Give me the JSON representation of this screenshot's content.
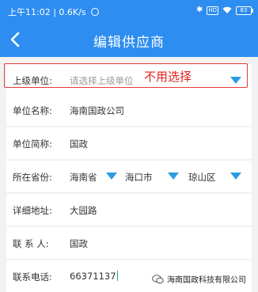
{
  "status_bar": {
    "time": "上午11:02",
    "speed": "0.6K/s",
    "battery": "83"
  },
  "header": {
    "title": "编辑供应商"
  },
  "form": {
    "parent": {
      "label": "上级单位:",
      "placeholder": "请选择上级单位"
    },
    "name": {
      "label": "单位名称:",
      "value": "海南国政公司"
    },
    "short_name": {
      "label": "单位简称:",
      "value": "国政"
    },
    "location": {
      "label": "所在省份:",
      "province": "海南省",
      "city": "海口市",
      "district": "琼山区"
    },
    "address": {
      "label": "详细地址:",
      "value": "大园路"
    },
    "contact": {
      "label": "联 系 人:",
      "value": "国政"
    },
    "phone": {
      "label": "联系电话:",
      "value": "66371137"
    }
  },
  "annotation": {
    "text": "不用选择",
    "color": "#e0201f"
  },
  "watermark": {
    "text": "海南国政科技有限公司"
  },
  "colors": {
    "primary": "#2d8df0",
    "dropdown_arrow": "#2d9be0",
    "highlight_box": "#e43b3b"
  }
}
